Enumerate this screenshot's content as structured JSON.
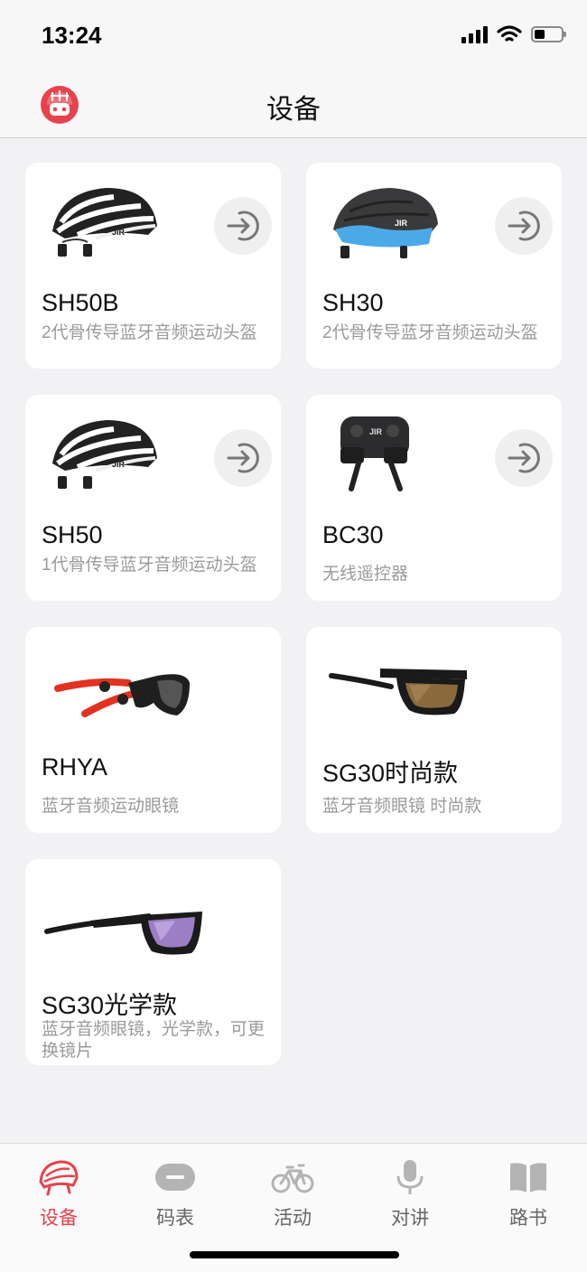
{
  "status": {
    "time": "13:24",
    "battery_level": 0.4
  },
  "header": {
    "title": "设备"
  },
  "devices": [
    {
      "name": "SH50B",
      "desc": "2代骨传导蓝牙音频运动头盔",
      "icon": "helmet-white-icon",
      "connectable": true
    },
    {
      "name": "SH30",
      "desc": "2代骨传导蓝牙音频运动头盔",
      "icon": "helmet-blue-icon",
      "connectable": true
    },
    {
      "name": "SH50",
      "desc": "1代骨传导蓝牙音频运动头盔",
      "icon": "helmet-white-icon",
      "connectable": true
    },
    {
      "name": "BC30",
      "desc": "无线遥控器",
      "icon": "remote-control-icon",
      "connectable": true
    },
    {
      "name": "RHYA",
      "desc": "蓝牙音频运动眼镜",
      "icon": "sport-glasses-icon",
      "connectable": false
    },
    {
      "name": "SG30时尚款",
      "desc": "蓝牙音频眼镜 时尚款",
      "icon": "fashion-glasses-icon",
      "connectable": false
    },
    {
      "name": "SG30光学款",
      "desc": "蓝牙音频眼镜，光学款，可更换镜片",
      "icon": "optical-glasses-icon",
      "connectable": false
    }
  ],
  "tabs": [
    {
      "label": "设备",
      "icon": "helmet-icon",
      "active": true
    },
    {
      "label": "码表",
      "icon": "bike-computer-icon",
      "active": false
    },
    {
      "label": "活动",
      "icon": "bicycle-icon",
      "active": false
    },
    {
      "label": "对讲",
      "icon": "microphone-icon",
      "active": false
    },
    {
      "label": "路书",
      "icon": "book-icon",
      "active": false
    }
  ],
  "colors": {
    "accent": "#e8424c",
    "inactive": "#9a9a9a",
    "background": "#f2f2f4"
  }
}
